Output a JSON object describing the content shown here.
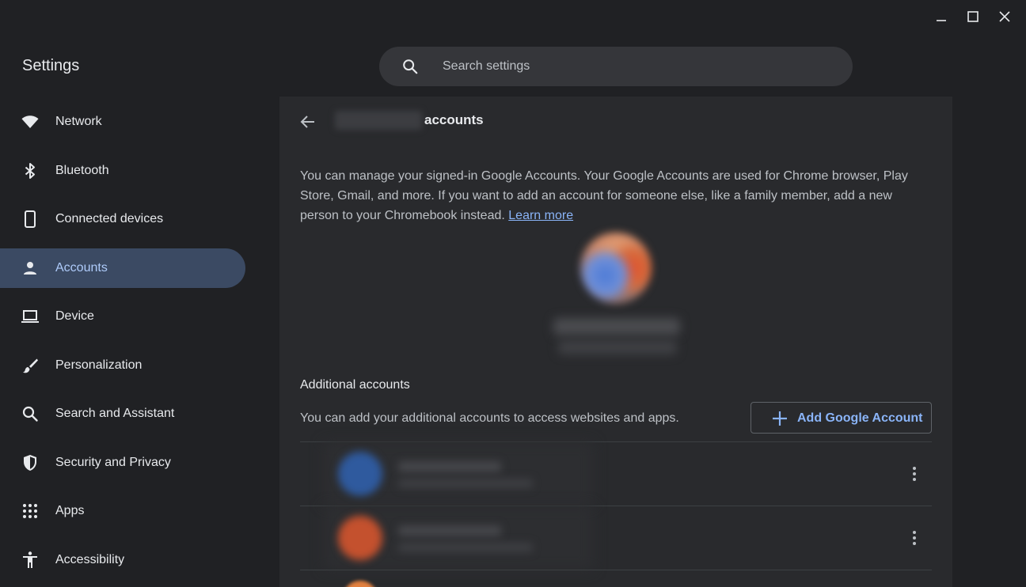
{
  "window": {
    "controls": [
      {
        "name": "minimize",
        "icon": "minimize-icon"
      },
      {
        "name": "maximize",
        "icon": "maximize-icon"
      },
      {
        "name": "close",
        "icon": "close-icon"
      }
    ]
  },
  "header": {
    "title": "Settings",
    "search": {
      "placeholder": "Search settings",
      "value": "",
      "icon": "search-icon"
    }
  },
  "sidebar": {
    "items": [
      {
        "label": "Network",
        "icon": "wifi-icon",
        "active": false
      },
      {
        "label": "Bluetooth",
        "icon": "bluetooth-icon",
        "active": false
      },
      {
        "label": "Connected devices",
        "icon": "phone-icon",
        "active": false
      },
      {
        "label": "Accounts",
        "icon": "person-icon",
        "active": true
      },
      {
        "label": "Device",
        "icon": "laptop-icon",
        "active": false
      },
      {
        "label": "Personalization",
        "icon": "brush-icon",
        "active": false
      },
      {
        "label": "Search and Assistant",
        "icon": "search-icon",
        "active": false
      },
      {
        "label": "Security and Privacy",
        "icon": "shield-icon",
        "active": false
      },
      {
        "label": "Apps",
        "icon": "apps-grid-icon",
        "active": false
      },
      {
        "label": "Accessibility",
        "icon": "accessibility-icon",
        "active": false
      }
    ]
  },
  "main": {
    "title": "accounts",
    "description": "You can manage your signed-in Google Accounts. Your Google Accounts are used for Chrome browser, Play Store, Gmail, and more. If you want to add an account for someone else, like a family member, add a new person to your Chromebook instead.",
    "learn_more": "Learn more",
    "additional": {
      "title": "Additional accounts",
      "description": "You can add your additional accounts to access websites and apps.",
      "add_button": "Add Google Account"
    }
  },
  "colors": {
    "background": "#202124",
    "panel": "#292a2d",
    "active_nav": "#3b4a63",
    "accent": "#8ab4f8",
    "text": "#e8eaed",
    "secondary_text": "#bdc1c6"
  }
}
